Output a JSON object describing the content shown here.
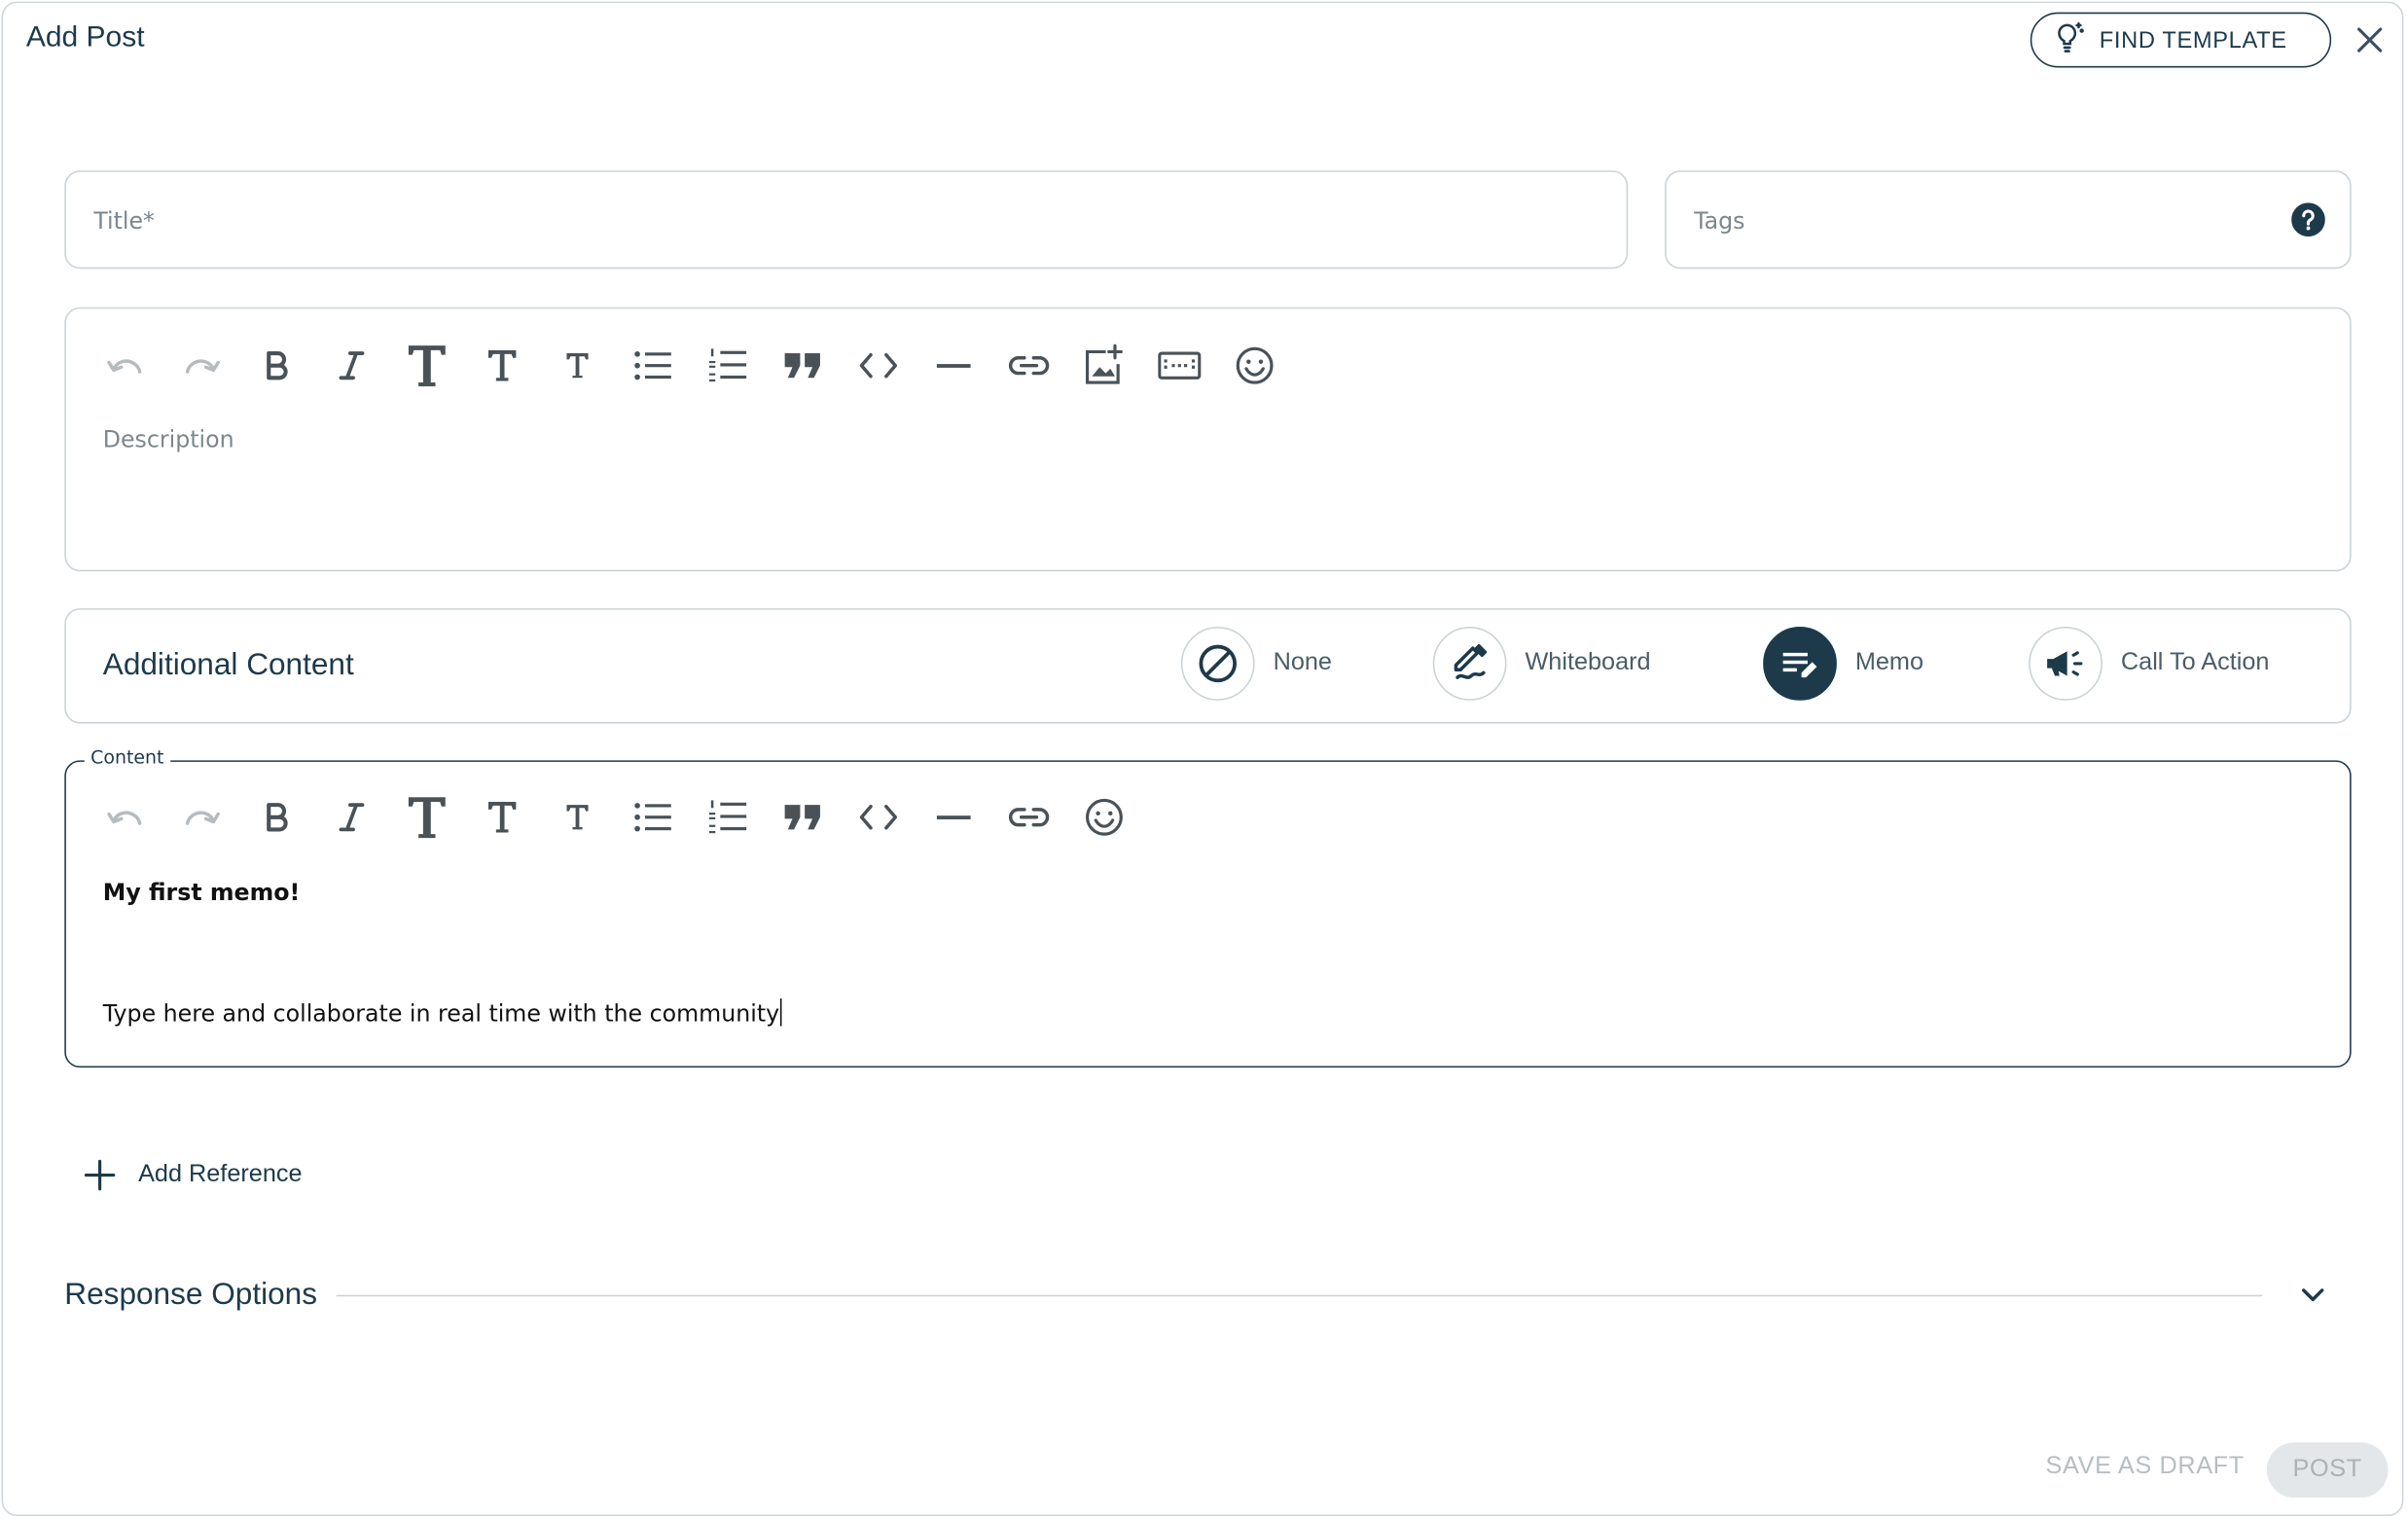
{
  "dialog": {
    "title": "Add Post",
    "find_template_label": "FIND TEMPLATE"
  },
  "title_field": {
    "placeholder": "Title*",
    "value": ""
  },
  "tags_field": {
    "placeholder": "Tags",
    "value": ""
  },
  "description_editor": {
    "placeholder": "Description",
    "toolbar": [
      "undo-icon",
      "redo-icon",
      "bold-icon",
      "italic-icon",
      "heading-1-icon",
      "heading-2-icon",
      "heading-3-icon",
      "bullet-list-icon",
      "numbered-list-icon",
      "quote-icon",
      "code-icon",
      "horizontal-rule-icon",
      "link-icon",
      "insert-image-icon",
      "embed-video-icon",
      "emoji-icon"
    ]
  },
  "additional_content": {
    "title": "Additional Content",
    "options": [
      {
        "label": "None",
        "icon": "none-icon",
        "selected": false
      },
      {
        "label": "Whiteboard",
        "icon": "whiteboard-icon",
        "selected": false
      },
      {
        "label": "Memo",
        "icon": "memo-icon",
        "selected": true
      },
      {
        "label": "Call To Action",
        "icon": "megaphone-icon",
        "selected": false
      }
    ]
  },
  "content_editor": {
    "legend": "Content",
    "toolbar": [
      "undo-icon",
      "redo-icon",
      "bold-icon",
      "italic-icon",
      "heading-1-icon",
      "heading-2-icon",
      "heading-3-icon",
      "bullet-list-icon",
      "numbered-list-icon",
      "quote-icon",
      "code-icon",
      "horizontal-rule-icon",
      "link-icon",
      "emoji-icon"
    ],
    "heading": "My first memo!",
    "body": "Type here and collaborate in real time with the community"
  },
  "add_reference_label": "Add Reference",
  "response_options_label": "Response Options",
  "footer": {
    "save_draft_label": "SAVE AS DRAFT",
    "post_label": "POST"
  },
  "colors": {
    "primary": "#1d3a4b",
    "border": "#cbd3d7",
    "muted_text": "#7b878e",
    "disabled_text": "#b7bec2",
    "disabled_bg": "#e4e7e9"
  }
}
